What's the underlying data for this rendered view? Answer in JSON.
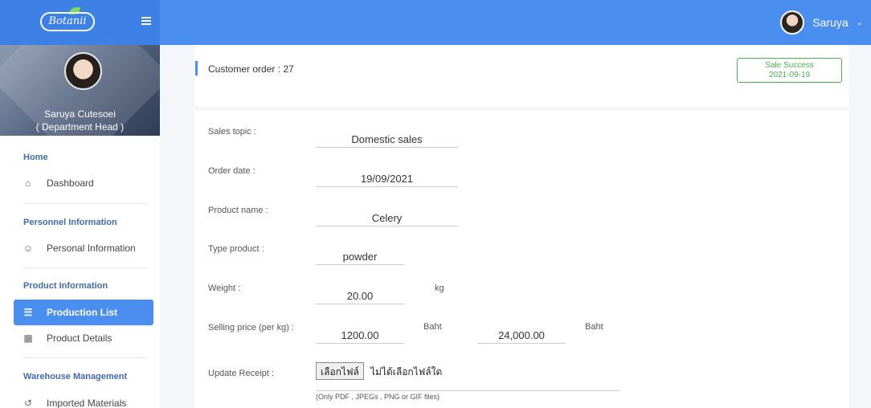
{
  "header": {
    "logo_text": "Botanii",
    "user_name": "Saruya"
  },
  "sidebar": {
    "profile_name": "Saruya Cutesoei",
    "profile_role": "( Department Head )",
    "sections": [
      {
        "heading": "Home",
        "items": [
          {
            "label": "Dashboard",
            "icon": "home-icon"
          }
        ]
      },
      {
        "heading": "Personnel Information",
        "items": [
          {
            "label": "Personal Information",
            "icon": "user-icon"
          }
        ]
      },
      {
        "heading": "Product Information",
        "items": [
          {
            "label": "Production List",
            "icon": "list-icon",
            "active": true
          },
          {
            "label": "Product Details",
            "icon": "grid-icon"
          }
        ]
      },
      {
        "heading": "Warehouse Management",
        "items": [
          {
            "label": "Imported Materials",
            "icon": "import-icon"
          }
        ]
      }
    ]
  },
  "order": {
    "title": "Customer order : 27",
    "status": "Sale Success",
    "status_date": "2021-09-19"
  },
  "form": {
    "sales_topic_label": "Sales topic :",
    "sales_topic_value": "Domestic sales",
    "order_date_label": "Order date :",
    "order_date_value": "19/09/2021",
    "product_name_label": "Product name :",
    "product_name_value": "Celery",
    "type_product_label": "Type product :",
    "type_product_value": "powder",
    "weight_label": "Weight :",
    "weight_value": "20.00",
    "weight_unit": "kg",
    "price_label": "Selling price (per kg) :",
    "price_value": "1200.00",
    "price_unit": "Baht",
    "total_value": "24,000.00",
    "total_unit": "Baht",
    "receipt_label": "Update Receipt :",
    "file_button": "เลือกไฟล์",
    "file_status": "ไม่ได้เลือกไฟล์ใด",
    "file_hint": "(Only PDF , JPEGs , PNG or GIF files)"
  },
  "colors": {
    "primary": "#4a8ff0",
    "success": "#4caf50"
  }
}
